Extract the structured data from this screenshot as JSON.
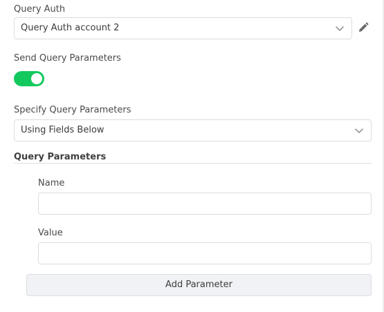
{
  "query_auth": {
    "label": "Query Auth",
    "selected": "Query Auth account 2",
    "chevron_icon": "chevron-down-icon",
    "edit_icon": "pencil-icon"
  },
  "send_query": {
    "label": "Send Query Parameters",
    "enabled": true,
    "toggle_color": "#13c95e"
  },
  "specify_query": {
    "label": "Specify Query Parameters",
    "selected": "Using Fields Below",
    "chevron_icon": "chevron-down-icon"
  },
  "query_parameters": {
    "heading": "Query Parameters",
    "name_label": "Name",
    "name_value": "",
    "value_label": "Value",
    "value_value": "",
    "add_button": "Add Parameter"
  }
}
